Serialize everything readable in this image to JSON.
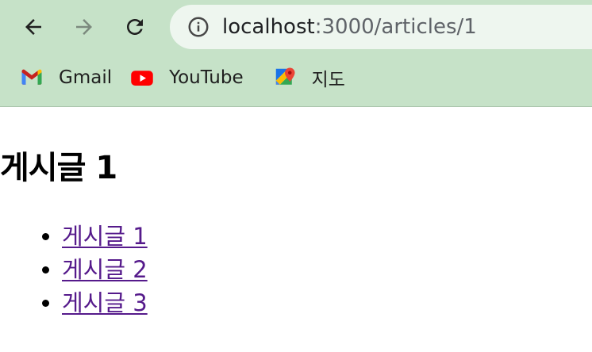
{
  "browser": {
    "url_host": "localhost",
    "url_path": ":3000/articles/1",
    "icons": {
      "back": "arrow-left-icon",
      "forward": "arrow-right-icon",
      "reload": "reload-icon",
      "site_info": "info-icon"
    },
    "bookmarks": [
      {
        "label": "Gmail",
        "icon": "gmail-icon"
      },
      {
        "label": "YouTube",
        "icon": "youtube-icon"
      },
      {
        "label": "지도",
        "icon": "maps-icon"
      }
    ],
    "colors": {
      "toolbar_bg": "#c6e2c8",
      "omnibox_bg": "#eef6ef"
    }
  },
  "page": {
    "heading": "게시글 1",
    "links": [
      {
        "label": "게시글 1"
      },
      {
        "label": "게시글 2"
      },
      {
        "label": "게시글 3"
      }
    ],
    "colors": {
      "visited_link": "#551a8b"
    }
  }
}
